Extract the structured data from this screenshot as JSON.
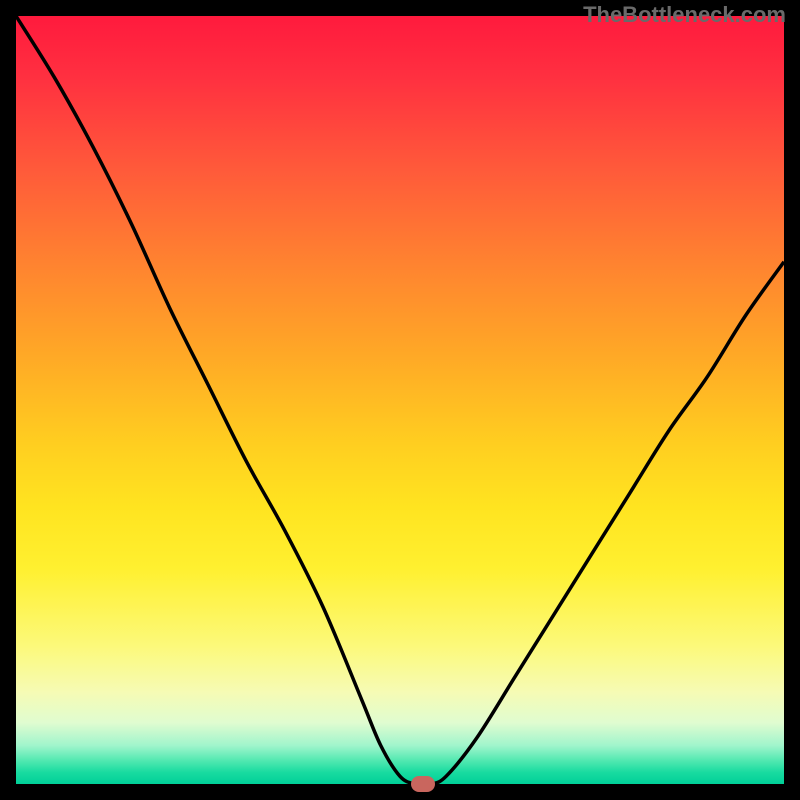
{
  "watermark": "TheBottleneck.com",
  "chart_data": {
    "type": "line",
    "title": "",
    "xlabel": "",
    "ylabel": "",
    "xlim": [
      0,
      100
    ],
    "ylim": [
      0,
      100
    ],
    "x": [
      0,
      5,
      10,
      15,
      20,
      25,
      30,
      35,
      40,
      45,
      47.5,
      50,
      52,
      54,
      56,
      60,
      65,
      70,
      75,
      80,
      85,
      90,
      95,
      100
    ],
    "y": [
      100,
      92,
      83,
      73,
      62,
      52,
      42,
      33,
      23,
      11,
      5,
      1,
      0,
      0,
      1,
      6,
      14,
      22,
      30,
      38,
      46,
      53,
      61,
      68
    ],
    "marker": {
      "x": 53,
      "y": 0
    },
    "background_gradient": {
      "top_color": "#ff1a3d",
      "mid_color": "#ffe420",
      "bottom_color": "#00d098"
    }
  }
}
